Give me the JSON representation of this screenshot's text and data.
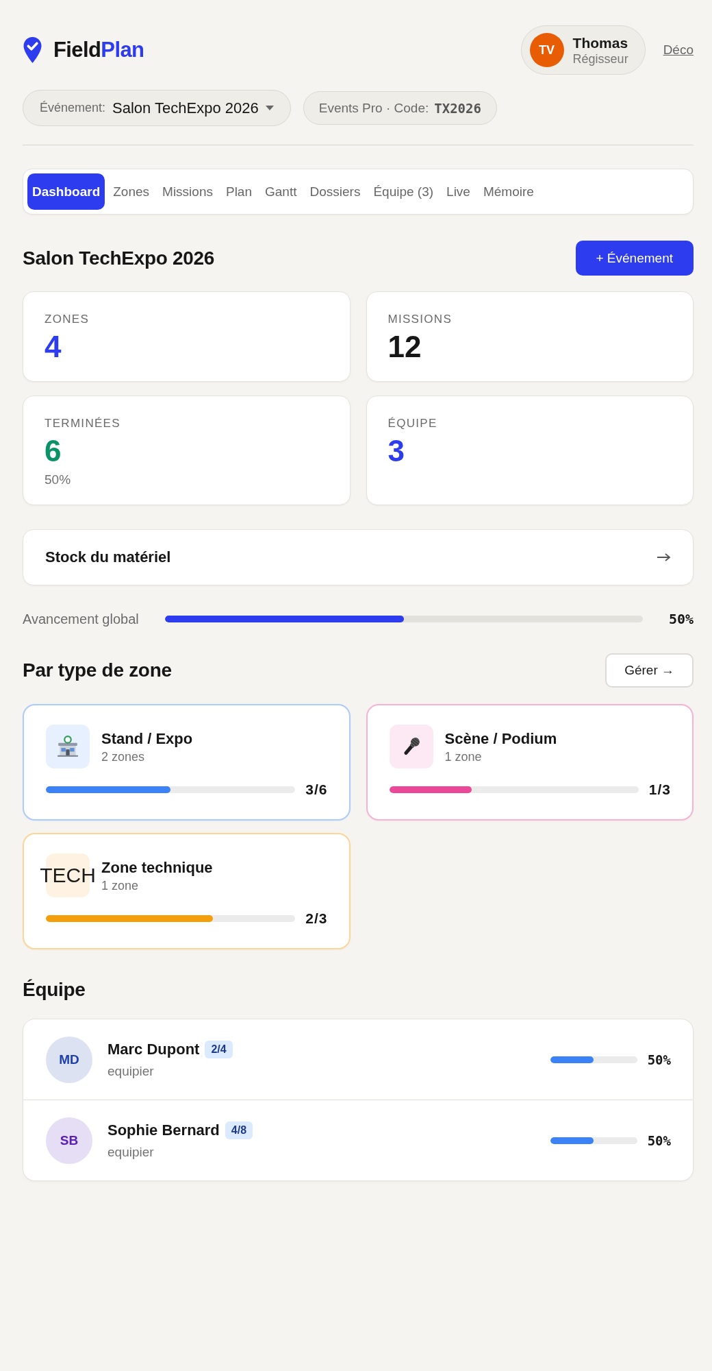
{
  "header": {
    "logo": {
      "text": "Field",
      "accent": "Plan"
    },
    "user": {
      "initials": "TV",
      "name": "Thomas",
      "role": "Régisseur"
    },
    "logout_link": "Déco"
  },
  "event_bar": {
    "event_select": {
      "label": "Événement:",
      "value": "Salon TechExpo 2026"
    },
    "org_chip": {
      "label": "Events Pro · Code:",
      "code": "TX2026"
    }
  },
  "tabs": [
    {
      "label": "Dashboard",
      "selected": true
    },
    {
      "label": "Zones",
      "selected": false
    },
    {
      "label": "Missions",
      "selected": false
    },
    {
      "label": "Plan",
      "selected": false
    },
    {
      "label": "Gantt",
      "selected": false
    },
    {
      "label": "Dossiers",
      "selected": false
    },
    {
      "label": "Équipe (3)",
      "selected": false
    },
    {
      "label": "Live",
      "selected": false
    },
    {
      "label": "Mémoire",
      "selected": false
    }
  ],
  "page_title": "Salon TechExpo 2026",
  "new_event_button": "+ Événement",
  "stats": [
    {
      "label": "ZONES",
      "value": "4",
      "color": "#2d3cef"
    },
    {
      "label": "MISSIONS",
      "value": "12",
      "color": "#171717"
    },
    {
      "label": "TERMINÉES",
      "value": "6",
      "color": "#0a9466",
      "sub": "50%"
    },
    {
      "label": "ÉQUIPE",
      "value": "3",
      "color": "#2d3cef"
    }
  ],
  "stock_link": {
    "label": "Stock du matériel"
  },
  "progress": {
    "label": "Avancement global",
    "level": 0.5,
    "reading": "50%"
  },
  "zone_types": {
    "title": "Par type de zone",
    "manage_button": "Gérer →",
    "items": [
      {
        "kind": "shop",
        "name": "Stand / Expo",
        "count": "2 zones",
        "level": 0.5,
        "reading": "3/6",
        "color": "#3b82f6"
      },
      {
        "kind": "microphone",
        "name": "Scène / Podium",
        "count": "1 zone",
        "level": 0.33,
        "reading": "1/3",
        "color": "#ec4899"
      },
      {
        "kind": "text",
        "icon_text": "TECH",
        "name": "Zone technique",
        "count": "1 zone",
        "level": 0.67,
        "reading": "2/3",
        "color": "#f59e0b"
      }
    ]
  },
  "team": {
    "title": "Équipe",
    "members": [
      {
        "initials": "MD",
        "name": "Marc Dupont",
        "tasks": "2/4",
        "role": "equipier",
        "level": 0.5,
        "reading": "50%",
        "color": "#1e40af"
      },
      {
        "initials": "SB",
        "name": "Sophie Bernard",
        "tasks": "4/8",
        "role": "equipier",
        "level": 0.5,
        "reading": "50%",
        "color": "#5b21b6"
      }
    ]
  }
}
